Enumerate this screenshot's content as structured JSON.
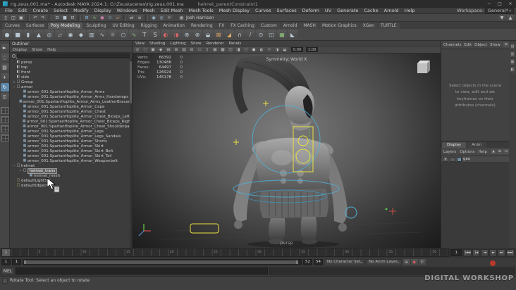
{
  "window": {
    "title_main": "rig.zeus.001.ma* - Autodesk MAYA 2024.1: G:\\Zeus\\scenes\\rig.zeus.001.ma",
    "title_node": "helmet_parentConstraint1",
    "buttons": [
      {
        "n": "minimize-button",
        "g": "−"
      },
      {
        "n": "maximize-button",
        "g": "□"
      },
      {
        "n": "close-button",
        "g": "×"
      }
    ]
  },
  "menubar": {
    "items": [
      "File",
      "Edit",
      "Create",
      "Select",
      "Modify",
      "Display",
      "Windows",
      "Mesh",
      "Edit Mesh",
      "Mesh Tools",
      "Mesh Display",
      "Curves",
      "Surfaces",
      "Deform",
      "UV",
      "Generate",
      "Cache",
      "Arnold",
      "Help"
    ],
    "workspace_label": "Workspace:",
    "workspace_value": "General*"
  },
  "statusline": {
    "account": "Josh Harrison",
    "icons": [
      {
        "n": "new-scene-icon",
        "g": "▯"
      },
      {
        "n": "open-scene-icon",
        "g": "◫"
      },
      {
        "n": "save-scene-icon",
        "g": "▣"
      },
      {
        "sep": true
      },
      {
        "n": "undo-icon",
        "g": "↶"
      },
      {
        "n": "redo-icon",
        "g": "↷"
      },
      {
        "sep": true
      },
      {
        "n": "select-hierarchy-icon",
        "g": "⊟",
        "c": "#b9c7d1"
      },
      {
        "n": "select-object-icon",
        "g": "■",
        "c": "#b9c7d1"
      },
      {
        "n": "select-component-icon",
        "g": "⊡",
        "c": "#b9c7d1"
      },
      {
        "sep": true
      },
      {
        "n": "snap-grid-icon",
        "g": "⊞",
        "c": "#7fb2d9"
      },
      {
        "n": "snap-curve-icon",
        "g": "∿",
        "c": "#93c47c"
      },
      {
        "n": "snap-point-icon",
        "g": "●",
        "c": "#c27ba0"
      },
      {
        "n": "snap-projected-center-icon",
        "g": "⊙",
        "c": "#76a5af"
      },
      {
        "n": "snap-view-plane-icon",
        "g": "▱",
        "c": "#e0a866"
      },
      {
        "sep": true
      },
      {
        "n": "input-connections-icon",
        "g": "⇄"
      },
      {
        "n": "construction-history-icon",
        "g": "≡"
      },
      {
        "sep": true
      },
      {
        "n": "render-current-frame-icon",
        "g": "◉",
        "c": "#9ec7dd"
      },
      {
        "n": "ipr-render-icon",
        "g": "◎",
        "c": "#9ec7dd"
      },
      {
        "n": "render-settings-icon",
        "g": "☼",
        "c": "#cccccc"
      }
    ],
    "right_icons": [
      {
        "n": "sign-in-options-icon",
        "g": "▼"
      },
      {
        "n": "collapse-toolbar-icon",
        "g": "▲"
      }
    ]
  },
  "shelf": {
    "tabs": [
      {
        "label": "Curves"
      },
      {
        "label": "Surfaces"
      },
      {
        "label": "Poly Modeling",
        "active": true
      },
      {
        "label": "Sculpting"
      },
      {
        "label": "UV Editing"
      },
      {
        "label": "Rigging"
      },
      {
        "label": "Animation"
      },
      {
        "label": "Rendering"
      },
      {
        "label": "FX"
      },
      {
        "label": "FX Caching"
      },
      {
        "label": "Custom"
      },
      {
        "label": "Arnold"
      },
      {
        "label": "MASH"
      },
      {
        "label": "Motion Graphics"
      },
      {
        "label": "XGen"
      },
      {
        "label": "TURTLE"
      }
    ],
    "icons": [
      {
        "n": "poly-sphere-icon",
        "g": "●"
      },
      {
        "n": "poly-cube-icon",
        "g": "■"
      },
      {
        "n": "poly-cylinder-icon",
        "g": "▮"
      },
      {
        "n": "poly-cone-icon",
        "g": "▲"
      },
      {
        "n": "poly-torus-icon",
        "g": "◎"
      },
      {
        "n": "poly-plane-icon",
        "g": "▱"
      },
      {
        "n": "poly-disc-icon",
        "g": "◉"
      },
      {
        "n": "platonic-solid-icon",
        "g": "◆"
      },
      {
        "n": "poly-pipe-icon",
        "g": "▥"
      },
      {
        "n": "poly-helix-icon",
        "g": "∿"
      },
      {
        "n": "poly-gear-icon",
        "g": "☼"
      },
      {
        "n": "poly-soccer-ball-icon",
        "g": "○"
      },
      {
        "n": "sweep-mesh-icon",
        "g": "∿",
        "c": "#93c47c"
      },
      {
        "n": "poly-type-icon",
        "g": "T",
        "c": "#d9d9d9"
      },
      {
        "n": "svg-tool-icon",
        "g": "S",
        "c": "#d9d9d9"
      },
      {
        "n": "boolean-union-icon",
        "g": "◐",
        "c": "#e06666"
      },
      {
        "n": "boolean-difference-icon",
        "g": "◑",
        "c": "#e06666"
      },
      {
        "n": "combine-icon",
        "g": "⊕"
      },
      {
        "n": "separate-icon",
        "g": "⊗"
      },
      {
        "n": "smooth-icon",
        "g": "◒"
      },
      {
        "n": "extrude-icon",
        "g": "⊠",
        "c": "#e0a866"
      },
      {
        "n": "bevel-icon",
        "g": "◢",
        "c": "#e0a866"
      },
      {
        "n": "bridge-icon",
        "g": "∩"
      },
      {
        "n": "multi-cut-icon",
        "g": "/"
      },
      {
        "n": "target-weld-icon",
        "g": "⊙"
      },
      {
        "n": "mirror-icon",
        "g": "◫"
      },
      {
        "n": "quad-draw-icon",
        "g": "▦",
        "c": "#93c47c"
      },
      {
        "n": "crease-tool-icon",
        "g": "◣"
      }
    ]
  },
  "toolbox": {
    "tools": [
      {
        "n": "select-tool-icon",
        "g": "►"
      },
      {
        "n": "lasso-select-tool-icon",
        "g": "◌"
      },
      {
        "n": "paint-select-tool-icon",
        "g": "▨"
      },
      {
        "n": "move-tool-icon",
        "g": "+"
      },
      {
        "n": "rotate-tool-icon",
        "g": "↻",
        "active": true
      },
      {
        "n": "scale-tool-icon",
        "g": "⊡"
      }
    ],
    "layouts": [
      {
        "n": "layout-single-pane"
      },
      {
        "n": "layout-four-view"
      },
      {
        "n": "layout-persp-outliner"
      },
      {
        "n": "layout-persp-graph"
      }
    ]
  },
  "outliner": {
    "title": "Outliner",
    "menus": [
      "Display",
      "Show",
      "Help"
    ],
    "items": [
      {
        "toggle": "",
        "glyph": "◧",
        "icls": "tree-icon ic-camera",
        "icon": "camera-icon",
        "label": "persp",
        "indent": 0
      },
      {
        "toggle": "",
        "glyph": "◧",
        "icls": "tree-icon ic-camera",
        "icon": "camera-icon",
        "label": "top",
        "indent": 0
      },
      {
        "toggle": "",
        "glyph": "◧",
        "icls": "tree-icon ic-camera",
        "icon": "camera-icon",
        "label": "front",
        "indent": 0
      },
      {
        "toggle": "",
        "glyph": "◧",
        "icls": "tree-icon ic-camera",
        "icon": "camera-icon",
        "label": "side",
        "indent": 0
      },
      {
        "toggle": "+",
        "glyph": "□",
        "icls": "tree-icon ic-group",
        "icon": "group-icon",
        "label": "Group",
        "indent": 0
      },
      {
        "toggle": "−",
        "glyph": "□",
        "icls": "tree-icon ic-group",
        "icon": "group-icon",
        "label": "armor",
        "indent": 0
      },
      {
        "toggle": "",
        "glyph": "▦",
        "icls": "tree-icon ic-mesh",
        "icon": "mesh-icon",
        "label": "armor_001:SpartanHoplite_Armor_Arms",
        "indent": 1
      },
      {
        "toggle": "",
        "glyph": "▦",
        "icls": "tree-icon ic-mesh",
        "icon": "mesh-icon",
        "label": "armor_001:SpartanHoplite_Armor_Arms_Handwraps",
        "indent": 1
      },
      {
        "toggle": "",
        "glyph": "▦",
        "icls": "tree-icon ic-mesh",
        "icon": "mesh-icon",
        "label": "armor_001:SpartanHoplite_Armor_Arms_LeatherBracers",
        "indent": 1
      },
      {
        "toggle": "",
        "glyph": "▦",
        "icls": "tree-icon ic-mesh",
        "icon": "mesh-icon",
        "label": "armor_001:SpartanHoplite_Armor_Cape",
        "indent": 1
      },
      {
        "toggle": "",
        "glyph": "▦",
        "icls": "tree-icon ic-mesh",
        "icon": "mesh-icon",
        "label": "armor_001:SpartanHoplite_Armor_Chest",
        "indent": 1
      },
      {
        "toggle": "",
        "glyph": "▦",
        "icls": "tree-icon ic-mesh",
        "icon": "mesh-icon",
        "label": "armor_001:SpartanHoplite_Armor_Chest_Biceps_Left",
        "indent": 1
      },
      {
        "toggle": "",
        "glyph": "▦",
        "icls": "tree-icon ic-mesh",
        "icon": "mesh-icon",
        "label": "armor_001:SpartanHoplite_Armor_Chest_Biceps_Right",
        "indent": 1
      },
      {
        "toggle": "",
        "glyph": "▦",
        "icls": "tree-icon ic-mesh",
        "icon": "mesh-icon",
        "label": "armor_001:SpartanHoplite_Armor_Chest_Shoulderpad",
        "indent": 1
      },
      {
        "toggle": "",
        "glyph": "▦",
        "icls": "tree-icon ic-mesh",
        "icon": "mesh-icon",
        "label": "armor_001:SpartanHoplite_Armor_Legs",
        "indent": 1
      },
      {
        "toggle": "",
        "glyph": "▦",
        "icls": "tree-icon ic-mesh",
        "icon": "mesh-icon",
        "label": "armor_001:SpartanHoplite_Armor_Legs_Sandals",
        "indent": 1
      },
      {
        "toggle": "",
        "glyph": "▦",
        "icls": "tree-icon ic-mesh",
        "icon": "mesh-icon",
        "label": "armor_001:SpartanHoplite_Armor_Shorts",
        "indent": 1
      },
      {
        "toggle": "",
        "glyph": "▦",
        "icls": "tree-icon ic-mesh",
        "icon": "mesh-icon",
        "label": "armor_001:SpartanHoplite_Armor_Skirt",
        "indent": 1
      },
      {
        "toggle": "",
        "glyph": "▦",
        "icls": "tree-icon ic-mesh",
        "icon": "mesh-icon",
        "label": "armor_001:SpartanHoplite_Armor_Skirt_Belt",
        "indent": 1
      },
      {
        "toggle": "",
        "glyph": "▦",
        "icls": "tree-icon ic-mesh",
        "icon": "mesh-icon",
        "label": "armor_001:SpartanHoplite_Armor_Skirt_Tail",
        "indent": 1
      },
      {
        "toggle": "",
        "glyph": "▦",
        "icls": "tree-icon ic-mesh",
        "icon": "mesh-icon",
        "label": "armor_001:SpartanHoplite_Armor_Weaponbelt",
        "indent": 1
      },
      {
        "toggle": "−",
        "glyph": "□",
        "icls": "tree-icon ic-group",
        "icon": "group-icon",
        "label": "helmet",
        "indent": 0
      },
      {
        "toggle": "−",
        "glyph": "□",
        "icls": "tree-icon ic-group",
        "icon": "transform-icon",
        "label": "helmet_trans",
        "indent": 1,
        "selected": true
      },
      {
        "toggle": "",
        "glyph": "▦",
        "icls": "tree-icon ic-mesh",
        "icon": "mesh-icon",
        "label": "helmet_mesh",
        "indent": 2
      },
      {
        "toggle": "",
        "glyph": "□",
        "icls": "tree-icon ic-set",
        "icon": "set-icon",
        "label": "defaultLightSet",
        "indent": 0
      },
      {
        "toggle": "",
        "glyph": "□",
        "icls": "tree-icon ic-set",
        "icon": "set-icon",
        "label": "defaultObjectSet",
        "indent": 0
      }
    ]
  },
  "viewport": {
    "menus": [
      "View",
      "Shading",
      "Lighting",
      "Show",
      "Renderer",
      "Panels"
    ],
    "icons": [
      {
        "n": "select-camera-icon",
        "g": "◎"
      },
      {
        "n": "lock-camera-icon",
        "g": "◌"
      },
      {
        "n": "camera-attributes-icon",
        "g": "▣"
      },
      {
        "n": "bookmarks-icon",
        "g": "◆"
      },
      {
        "n": "image-plane-icon",
        "g": "▤"
      },
      {
        "n": "2d-pan-zoom-icon",
        "g": "⊞"
      },
      {
        "n": "grease-pencil-icon",
        "g": "▨"
      },
      {
        "n": "grid-icon",
        "g": "⊟"
      },
      {
        "n": "film-gate-icon",
        "g": "▭"
      },
      {
        "n": "resolution-gate-icon",
        "g": "▯"
      },
      {
        "n": "gate-mask-icon",
        "g": "▦"
      },
      {
        "n": "field-chart-icon",
        "g": "▩"
      },
      {
        "n": "safe-action-icon",
        "g": "◫"
      },
      {
        "n": "safe-title-icon",
        "g": "◨"
      },
      {
        "n": "wireframe-icon",
        "g": "○"
      },
      {
        "n": "shaded-icon",
        "g": "●"
      },
      {
        "n": "textured-icon",
        "g": "◐"
      },
      {
        "n": "lights-icon",
        "g": "☼"
      },
      {
        "n": "shadows-icon",
        "g": "◑"
      },
      {
        "n": "xray-icon",
        "g": "◒"
      }
    ],
    "exposure": "0.00",
    "gamma": "1.00",
    "symmetry_label": "Symmetry: World X",
    "camera_label": "persp",
    "hud_rows": [
      {
        "label": "Verts:",
        "value": "66392",
        "sel": "0"
      },
      {
        "label": "Edges:",
        "value": "130488",
        "sel": "0"
      },
      {
        "label": "Faces:",
        "value": "64497",
        "sel": "0"
      },
      {
        "label": "Tris:",
        "value": "126924",
        "sel": "0"
      },
      {
        "label": "UVs:",
        "value": "145178",
        "sel": "0"
      }
    ]
  },
  "channelbox": {
    "menus": [
      "Channels",
      "Edit",
      "Object",
      "Show"
    ],
    "icons": [
      {
        "n": "show-manipulators-icon",
        "g": "⊞"
      },
      {
        "n": "channel-display-options-icon",
        "g": "▼"
      }
    ],
    "empty_message": "Select objects in the scene to view, edit and set keyframes on their attributes (channels)"
  },
  "layers": {
    "tabs": [
      {
        "label": "Display",
        "active": true
      },
      {
        "label": "Anim"
      }
    ],
    "menus": [
      "Layers",
      "Options",
      "Help"
    ],
    "icons": [
      {
        "n": "move-layer-up-icon",
        "g": "▲"
      },
      {
        "n": "new-empty-layer-icon",
        "g": "⊞"
      },
      {
        "n": "new-layer-from-selected-icon",
        "g": "⊡"
      }
    ],
    "rows": [
      {
        "v": "V",
        "t": "",
        "name": "geo"
      }
    ]
  },
  "rightstrip": {
    "icons": [
      {
        "n": "channel-box-tab-icon",
        "g": "▤"
      },
      {
        "n": "attribute-editor-tab-icon",
        "g": "▥"
      },
      {
        "n": "tool-settings-tab-icon",
        "g": "▦"
      },
      {
        "n": "modeling-toolkit-tab-icon",
        "g": "◧"
      }
    ]
  },
  "timeline": {
    "current": "1",
    "min": "1",
    "max": "52",
    "labels": [
      "1",
      "5",
      "10",
      "15",
      "20",
      "25",
      "30",
      "35",
      "40",
      "45",
      "50"
    ],
    "playback": [
      {
        "n": "go-to-start-button",
        "g": "|◄◄"
      },
      {
        "n": "step-back-key-button",
        "g": "|◄"
      },
      {
        "n": "step-back-frame-button",
        "g": "◄"
      },
      {
        "n": "play-forward-button",
        "g": "►"
      },
      {
        "n": "step-forward-key-button",
        "g": "►|"
      },
      {
        "n": "go-to-end-button",
        "g": "►►|"
      }
    ]
  },
  "range": {
    "anim_start": "1",
    "play_start": "1",
    "play_end": "52",
    "anim_end": "54",
    "character_set": "No Character Set",
    "anim_layer": "No Anim Layer",
    "icons": [
      {
        "n": "playback-options-icon",
        "g": "≡"
      },
      {
        "n": "auto-keyframe-icon",
        "g": "◆",
        "c": "#cf5f5f"
      },
      {
        "n": "animation-preferences-icon",
        "g": "☼"
      }
    ]
  },
  "commandline": {
    "label": "MEL"
  },
  "helpline": {
    "text": "Rotate Tool: Select an object to rotate"
  },
  "watermark": {
    "text": "DIGITAL WORKSHOP"
  },
  "colors": {
    "accent_blue": "#5285a6",
    "control_blue": "#4fb0d6",
    "control_yellow": "#eae23f",
    "axis_red": "#d14b4b",
    "axis_green": "#6fcf4a",
    "watermark_red": "#c0392b",
    "maya_teal": "#2da8c2"
  }
}
